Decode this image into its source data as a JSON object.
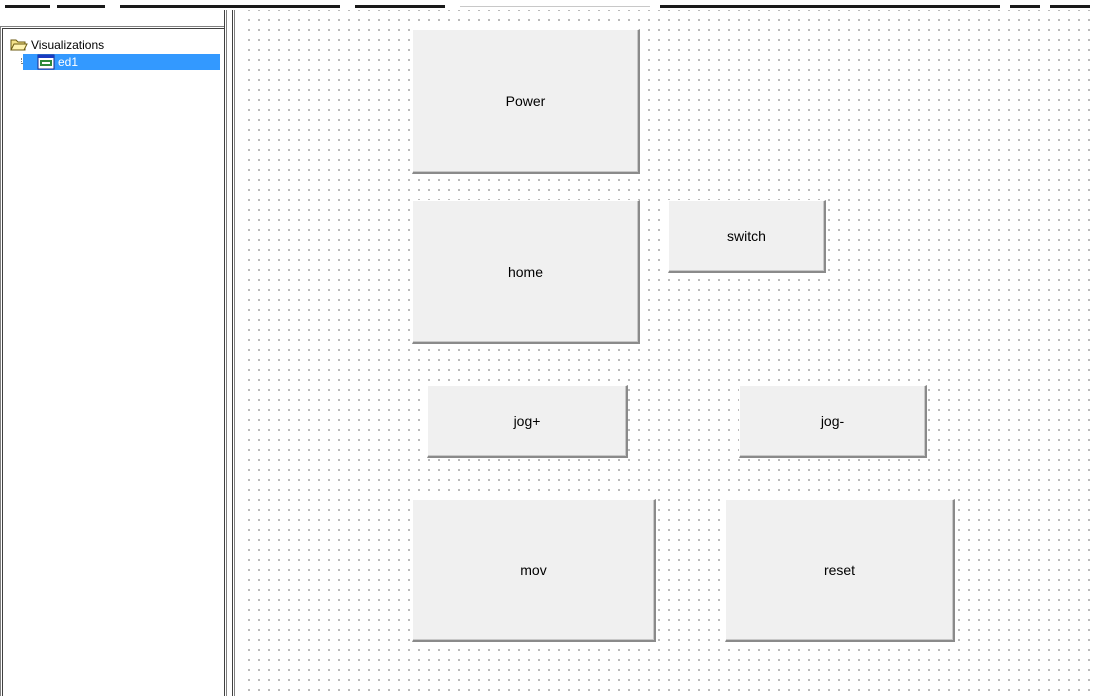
{
  "tree": {
    "root": {
      "label": "Visualizations",
      "icon": "folder-open-icon"
    },
    "items": [
      {
        "label": "ed1",
        "icon": "visualization-icon",
        "selected": true
      }
    ],
    "selection_color": "#3399ff"
  },
  "canvas": {
    "grid": true,
    "buttons": {
      "power": "Power",
      "home": "home",
      "switch": "switch",
      "jog_plus": "jog+",
      "jog_minus": "jog-",
      "mov": "mov",
      "reset": "reset"
    },
    "button_color": "#f0f0f0"
  }
}
